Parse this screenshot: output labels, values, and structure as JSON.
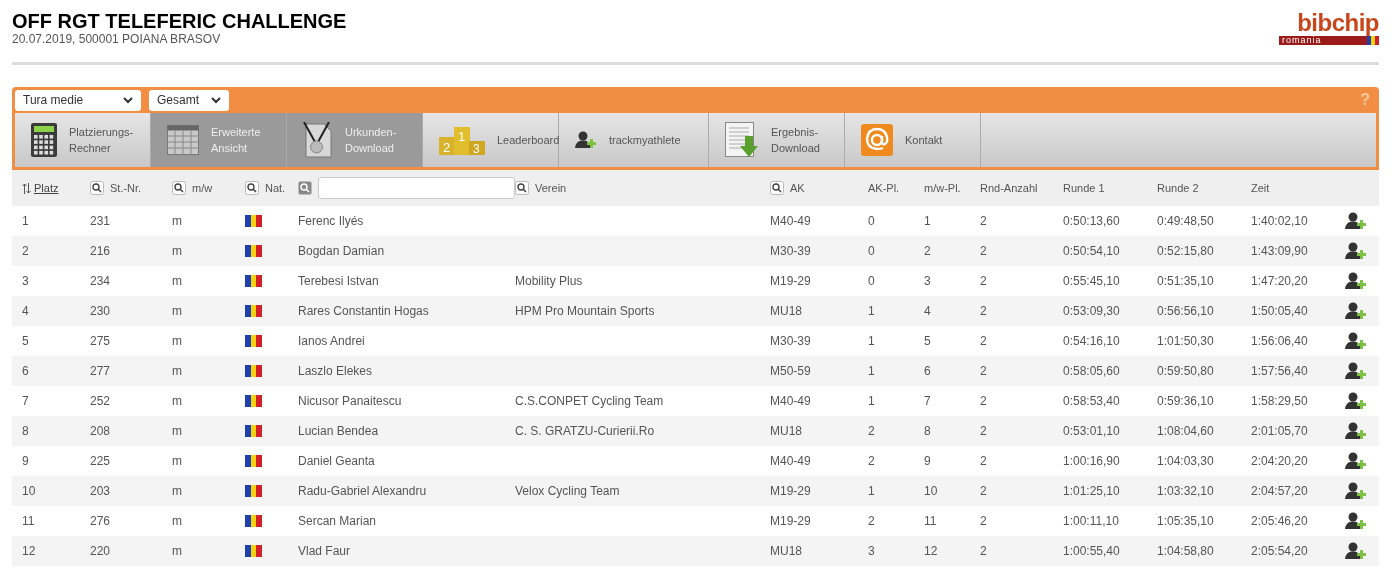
{
  "header": {
    "title": "OFF RGT TELEFERIC CHALLENGE",
    "subtitle": "20.07.2019, 500001 POIANA BRASOV"
  },
  "logo": {
    "name": "bibchip",
    "country": "romania"
  },
  "toolbar": {
    "dropdowns": [
      {
        "value": "Tura medie"
      },
      {
        "value": "Gesamt"
      }
    ],
    "help": "?"
  },
  "tabs": [
    {
      "label": "Platzierungs-\nRechner",
      "kind": "calculator",
      "selected": false
    },
    {
      "label": "Erweiterte\nAnsicht",
      "kind": "table",
      "selected": true
    },
    {
      "label": "Urkunden-\nDownload",
      "kind": "medal",
      "selected": true
    },
    {
      "label": "Leaderboard",
      "kind": "podium",
      "places": [
        "2",
        "1",
        "3"
      ],
      "selected": false
    },
    {
      "label": "trackmyathlete",
      "kind": "person",
      "selected": false
    },
    {
      "label": "Ergebnis-\nDownload",
      "kind": "download",
      "selected": false
    },
    {
      "label": "Kontakt",
      "kind": "at",
      "selected": false
    }
  ],
  "columns": [
    {
      "label": "Platz",
      "kind": "sort"
    },
    {
      "label": "St.-Nr.",
      "kind": "search"
    },
    {
      "label": "m/w",
      "kind": "search"
    },
    {
      "label": "Nat.",
      "kind": "search"
    },
    {
      "kind": "input"
    },
    {
      "label": "Verein",
      "kind": "search"
    },
    {
      "label": "AK",
      "kind": "search"
    },
    {
      "label": "AK-Pl.",
      "kind": "plain"
    },
    {
      "label": "m/w-Pl.",
      "kind": "plain"
    },
    {
      "label": "Rnd-Anzahl",
      "kind": "plain"
    },
    {
      "label": "Runde 1",
      "kind": "plain"
    },
    {
      "label": "Runde 2",
      "kind": "plain"
    },
    {
      "label": "Zeit",
      "kind": "plain"
    }
  ],
  "rows": [
    {
      "platz": "1",
      "bib": "231",
      "mw": "m",
      "name": "Ferenc Ilyés",
      "club": "",
      "ak": "M40-49",
      "akpl": "0",
      "mwpl": "1",
      "rnd": "2",
      "r1": "0:50:13,60",
      "r2": "0:49:48,50",
      "zeit": "1:40:02,10"
    },
    {
      "platz": "2",
      "bib": "216",
      "mw": "m",
      "name": "Bogdan Damian",
      "club": "",
      "ak": "M30-39",
      "akpl": "0",
      "mwpl": "2",
      "rnd": "2",
      "r1": "0:50:54,10",
      "r2": "0:52:15,80",
      "zeit": "1:43:09,90"
    },
    {
      "platz": "3",
      "bib": "234",
      "mw": "m",
      "name": "Terebesi Istvan",
      "club": "Mobility Plus",
      "ak": "M19-29",
      "akpl": "0",
      "mwpl": "3",
      "rnd": "2",
      "r1": "0:55:45,10",
      "r2": "0:51:35,10",
      "zeit": "1:47:20,20"
    },
    {
      "platz": "4",
      "bib": "230",
      "mw": "m",
      "name": "Rares Constantin Hogas",
      "club": "HPM Pro Mountain Sports",
      "ak": "MU18",
      "akpl": "1",
      "mwpl": "4",
      "rnd": "2",
      "r1": "0:53:09,30",
      "r2": "0:56:56,10",
      "zeit": "1:50:05,40"
    },
    {
      "platz": "5",
      "bib": "275",
      "mw": "m",
      "name": "Ianos Andrei",
      "club": "",
      "ak": "M30-39",
      "akpl": "1",
      "mwpl": "5",
      "rnd": "2",
      "r1": "0:54:16,10",
      "r2": "1:01:50,30",
      "zeit": "1:56:06,40"
    },
    {
      "platz": "6",
      "bib": "277",
      "mw": "m",
      "name": "Laszlo Elekes",
      "club": "",
      "ak": "M50-59",
      "akpl": "1",
      "mwpl": "6",
      "rnd": "2",
      "r1": "0:58:05,60",
      "r2": "0:59:50,80",
      "zeit": "1:57:56,40"
    },
    {
      "platz": "7",
      "bib": "252",
      "mw": "m",
      "name": "Nicusor Panaitescu",
      "club": "C.S.CONPET Cycling Team",
      "ak": "M40-49",
      "akpl": "1",
      "mwpl": "7",
      "rnd": "2",
      "r1": "0:58:53,40",
      "r2": "0:59:36,10",
      "zeit": "1:58:29,50"
    },
    {
      "platz": "8",
      "bib": "208",
      "mw": "m",
      "name": "Lucian Bendea",
      "club": "C. S. GRATZU-Curierii.Ro",
      "ak": "MU18",
      "akpl": "2",
      "mwpl": "8",
      "rnd": "2",
      "r1": "0:53:01,10",
      "r2": "1:08:04,60",
      "zeit": "2:01:05,70"
    },
    {
      "platz": "9",
      "bib": "225",
      "mw": "m",
      "name": "Daniel Geanta",
      "club": "",
      "ak": "M40-49",
      "akpl": "2",
      "mwpl": "9",
      "rnd": "2",
      "r1": "1:00:16,90",
      "r2": "1:04:03,30",
      "zeit": "2:04:20,20"
    },
    {
      "platz": "10",
      "bib": "203",
      "mw": "m",
      "name": "Radu-Gabriel Alexandru",
      "club": "Velox Cycling Team",
      "ak": "M19-29",
      "akpl": "1",
      "mwpl": "10",
      "rnd": "2",
      "r1": "1:01:25,10",
      "r2": "1:03:32,10",
      "zeit": "2:04:57,20"
    },
    {
      "platz": "11",
      "bib": "276",
      "mw": "m",
      "name": "Sercan Marian",
      "club": "",
      "ak": "M19-29",
      "akpl": "2",
      "mwpl": "11",
      "rnd": "2",
      "r1": "1:00:11,10",
      "r2": "1:05:35,10",
      "zeit": "2:05:46,20"
    },
    {
      "platz": "12",
      "bib": "220",
      "mw": "m",
      "name": "Vlad Faur",
      "club": "",
      "ak": "MU18",
      "akpl": "3",
      "mwpl": "12",
      "rnd": "2",
      "r1": "1:00:55,40",
      "r2": "1:04:58,80",
      "zeit": "2:05:54,20"
    }
  ]
}
